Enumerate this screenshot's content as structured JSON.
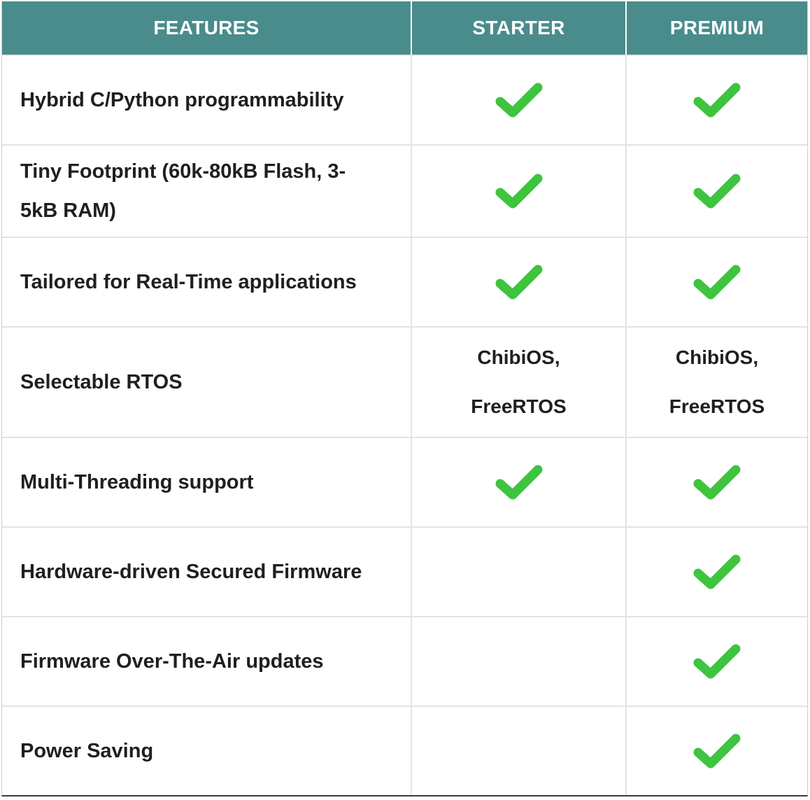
{
  "header": {
    "features": "FEATURES",
    "starter": "STARTER",
    "premium": "PREMIUM"
  },
  "rows": [
    {
      "feature": "Hybrid C/Python programmability",
      "starter": "check",
      "premium": "check"
    },
    {
      "feature": "Tiny Footprint (60k-80kB Flash, 3-5kB RAM)",
      "feature_line1": "Tiny Footprint (60k-80kB Flash, 3-",
      "feature_line2": "5kB RAM)",
      "starter": "check",
      "premium": "check"
    },
    {
      "feature": "Tailored for Real-Time applications",
      "starter": "check",
      "premium": "check"
    },
    {
      "feature": "Selectable RTOS",
      "starter_line1": "ChibiOS,",
      "starter_line2": "FreeRTOS",
      "premium_line1": "ChibiOS,",
      "premium_line2": "FreeRTOS"
    },
    {
      "feature": "Multi-Threading support",
      "starter": "check",
      "premium": "check"
    },
    {
      "feature": "Hardware-driven Secured Firmware",
      "starter": "",
      "premium": "check"
    },
    {
      "feature": "Firmware Over-The-Air updates",
      "starter": "",
      "premium": "check"
    },
    {
      "feature": "Power Saving",
      "starter": "",
      "premium": "check"
    }
  ],
  "colors": {
    "header_bg": "#4a8c8c",
    "check_green": "#3ec43e"
  },
  "icons": {
    "check": "checkmark-icon"
  }
}
